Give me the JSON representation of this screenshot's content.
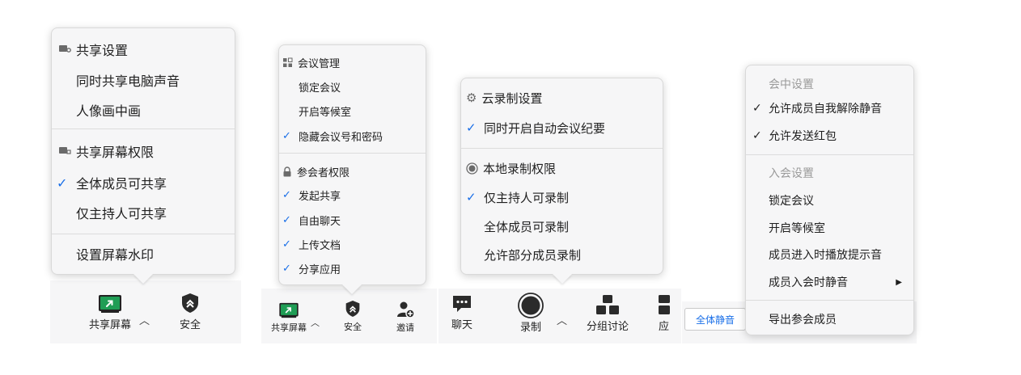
{
  "panel1": {
    "share_settings_header": "共享设置",
    "share_audio": "同时共享电脑声音",
    "pip": "人像画中画",
    "permission_header": "共享屏幕权限",
    "all_can_share": "全体成员可共享",
    "host_only_share": "仅主持人可共享",
    "watermark": "设置屏幕水印",
    "toolbar": {
      "share_label": "共享屏幕",
      "security_label": "安全"
    }
  },
  "panel2": {
    "meeting_mgmt_header": "会议管理",
    "lock_meeting": "锁定会议",
    "waiting_room": "开启等候室",
    "hide_id_pwd": "隐藏会议号和密码",
    "participant_perm_header": "参会者权限",
    "initiate_share": "发起共享",
    "free_chat": "自由聊天",
    "upload_docs": "上传文档",
    "share_apps": "分享应用",
    "toolbar": {
      "share_label": "共享屏幕",
      "security_label": "安全",
      "invite_label": "邀请",
      "chat_label": "聊天"
    }
  },
  "panel3": {
    "cloud_header": "云录制设置",
    "auto_minutes": "同时开启自动会议纪要",
    "local_header": "本地录制权限",
    "host_only_record": "仅主持人可录制",
    "all_can_record": "全体成员可录制",
    "allow_some_record": "允许部分成员录制",
    "toolbar": {
      "record_label": "录制",
      "breakout_label": "分组讨论",
      "apps_label_partial": "应"
    }
  },
  "panel4": {
    "in_meeting_header": "会中设置",
    "allow_unmute": "允许成员自我解除静音",
    "allow_red_packet": "允许发送红包",
    "join_header": "入会设置",
    "lock_meeting": "锁定会议",
    "waiting_room": "开启等候室",
    "join_tone": "成员进入时播放提示音",
    "mute_on_join": "成员入会时静音",
    "export_members": "导出参会成员",
    "mute_all_button": "全体静音"
  },
  "colors": {
    "check_blue": "#1a6fe8",
    "menu_bg": "#f6f6f7",
    "share_green": "#1f9d55"
  }
}
